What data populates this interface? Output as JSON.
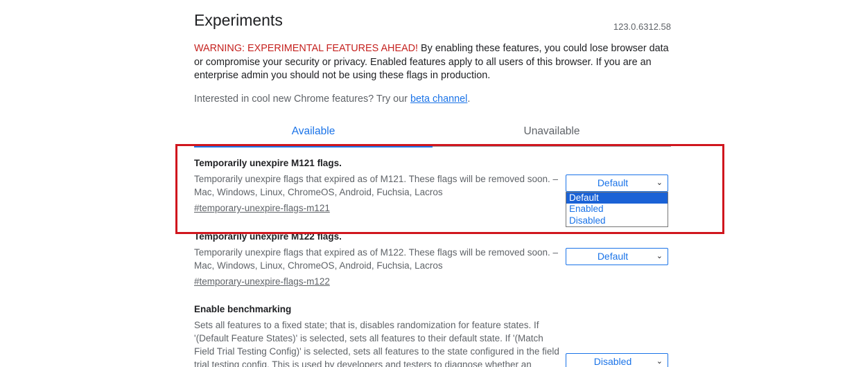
{
  "header": {
    "title": "Experiments",
    "version": "123.0.6312.58"
  },
  "warning": {
    "prefix": "WARNING: EXPERIMENTAL FEATURES AHEAD!",
    "body": " By enabling these features, you could lose browser data or compromise your security or privacy. Enabled features apply to all users of this browser. If you are an enterprise admin you should not be using these flags in production."
  },
  "interested": {
    "text": "Interested in cool new Chrome features? Try our ",
    "link": "beta channel",
    "suffix": "."
  },
  "tabs": {
    "available": "Available",
    "unavailable": "Unavailable"
  },
  "flags": [
    {
      "title": "Temporarily unexpire M121 flags.",
      "description": "Temporarily unexpire flags that expired as of M121. These flags will be removed soon. – Mac, Windows, Linux, ChromeOS, Android, Fuchsia, Lacros",
      "anchor": "#temporary-unexpire-flags-m121",
      "selected": "Default",
      "open": true,
      "options": [
        "Default",
        "Enabled",
        "Disabled"
      ]
    },
    {
      "title": "Temporarily unexpire M122 flags.",
      "description": "Temporarily unexpire flags that expired as of M122. These flags will be removed soon. – Mac, Windows, Linux, ChromeOS, Android, Fuchsia, Lacros",
      "anchor": "#temporary-unexpire-flags-m122",
      "selected": "Default"
    },
    {
      "title": "Enable benchmarking",
      "description": "Sets all features to a fixed state; that is, disables randomization for feature states. If '(Default Feature States)' is selected, sets all features to their default state. If '(Match Field Trial Testing Config)' is selected, sets all features to the state configured in the field trial testing config. This is used by developers and testers to diagnose whether an observed problem is caused",
      "selected": "Disabled"
    }
  ],
  "colors": {
    "accent": "#1a73e8",
    "warning": "#c5221f",
    "highlight": "#d0161e",
    "option_selected_bg": "#1a62d6"
  }
}
